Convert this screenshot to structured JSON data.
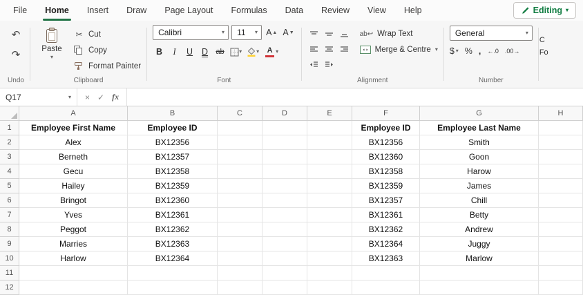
{
  "tabs": [
    "File",
    "Home",
    "Insert",
    "Draw",
    "Page Layout",
    "Formulas",
    "Data",
    "Review",
    "View",
    "Help"
  ],
  "active_tab": "Home",
  "editing": {
    "label": "Editing"
  },
  "icons": {
    "undo": "↶",
    "redo": "↷",
    "cut": "✂",
    "chevron_down": "▾",
    "cancel": "×",
    "enter": "✓",
    "wrap_arrow": "↩",
    "grow_font": "▲",
    "shrink_font": "▼",
    "font_letter": "A"
  },
  "ribbon": {
    "undo": {
      "label": "Undo"
    },
    "clipboard": {
      "label": "Clipboard",
      "paste": "Paste",
      "cut": "Cut",
      "copy": "Copy",
      "format_painter": "Format Painter"
    },
    "font": {
      "label": "Font",
      "family": "Calibri",
      "size": "11",
      "bold": "B",
      "italic": "I",
      "underline": "U",
      "double_underline": "D",
      "strikethrough": "ab"
    },
    "alignment": {
      "label": "Alignment",
      "wrap_text": "Wrap Text",
      "merge_centre": "Merge & Centre"
    },
    "number": {
      "label": "Number",
      "format": "General",
      "currency": "$",
      "percent": "%",
      "comma": ",",
      "increase_decimal": "←.0",
      "decrease_decimal": ".00→"
    },
    "overflow": {
      "line1": "C",
      "line2": "Fo"
    }
  },
  "formula_bar": {
    "name_box": "Q17",
    "cancel": "×",
    "enter": "✓",
    "fx": "fx",
    "value": ""
  },
  "colors": {
    "accent_green": "#107c41",
    "tab_underline": "#217346",
    "fill_yellow": "#ffd335",
    "font_red": "#d13438"
  },
  "sheet": {
    "columns": [
      "A",
      "B",
      "C",
      "D",
      "E",
      "F",
      "G",
      "H"
    ],
    "rows": [
      {
        "n": 1,
        "bold": true,
        "cells": {
          "A": "Employee First Name",
          "B": "Employee ID",
          "F": "Employee ID",
          "G": "Employee Last Name"
        }
      },
      {
        "n": 2,
        "cells": {
          "A": "Alex",
          "B": "BX12356",
          "F": "BX12356",
          "G": "Smith"
        }
      },
      {
        "n": 3,
        "cells": {
          "A": "Berneth",
          "B": "BX12357",
          "F": "BX12360",
          "G": "Goon"
        }
      },
      {
        "n": 4,
        "cells": {
          "A": "Gecu",
          "B": "BX12358",
          "F": "BX12358",
          "G": "Harow"
        }
      },
      {
        "n": 5,
        "cells": {
          "A": "Hailey",
          "B": "BX12359",
          "F": "BX12359",
          "G": "James"
        }
      },
      {
        "n": 6,
        "cells": {
          "A": "Bringot",
          "B": "BX12360",
          "F": "BX12357",
          "G": "Chill"
        }
      },
      {
        "n": 7,
        "cells": {
          "A": "Yves",
          "B": "BX12361",
          "F": "BX12361",
          "G": "Betty"
        }
      },
      {
        "n": 8,
        "cells": {
          "A": "Peggot",
          "B": "BX12362",
          "F": "BX12362",
          "G": "Andrew"
        }
      },
      {
        "n": 9,
        "cells": {
          "A": "Marries",
          "B": "BX12363",
          "F": "BX12364",
          "G": "Juggy"
        }
      },
      {
        "n": 10,
        "cells": {
          "A": "Harlow",
          "B": "BX12364",
          "F": "BX12363",
          "G": "Marlow"
        }
      },
      {
        "n": 11,
        "cells": {}
      },
      {
        "n": 12,
        "cells": {}
      }
    ]
  }
}
